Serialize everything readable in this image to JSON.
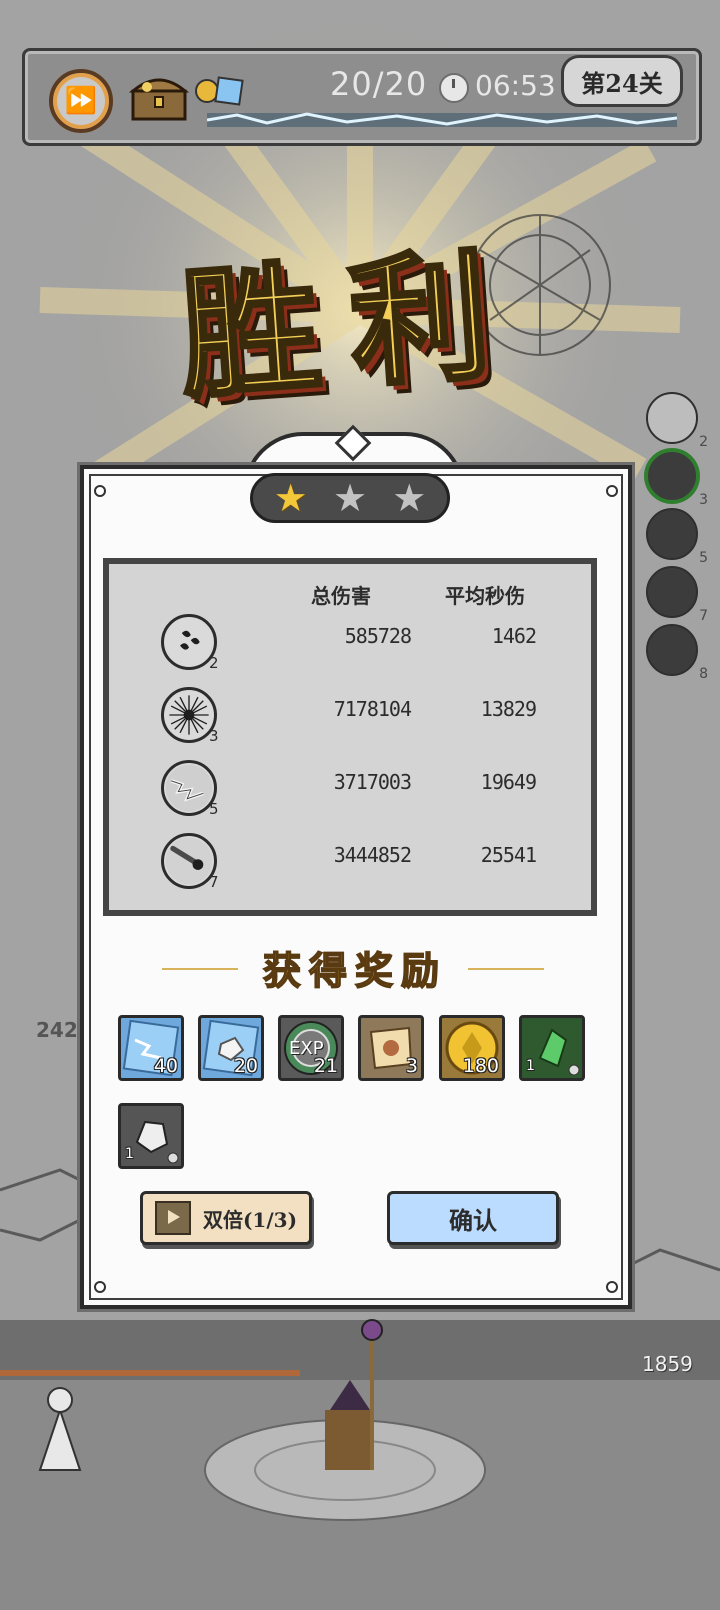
{
  "hud": {
    "wave": "20/20",
    "timer": "06:53",
    "level": "第24关"
  },
  "title": "胜利",
  "stars": {
    "earned": 1,
    "total": 3
  },
  "stats": {
    "col_total": "总伤害",
    "col_dps": "平均秒伤",
    "rows": [
      {
        "icon": "drops-skill-icon",
        "level": "2",
        "total": "585728",
        "dps": "1462"
      },
      {
        "icon": "thorn-burst-skill-icon",
        "level": "3",
        "total": "7178104",
        "dps": "13829"
      },
      {
        "icon": "lightning-skill-icon",
        "level": "5",
        "total": "3717003",
        "dps": "19649"
      },
      {
        "icon": "meteor-skill-icon",
        "level": "7",
        "total": "3444852",
        "dps": "25541"
      }
    ]
  },
  "rewards": {
    "title": "获得奖励",
    "items": [
      {
        "icon": "lightning-crystal-icon",
        "count": "40"
      },
      {
        "icon": "ice-crystal-icon",
        "count": "20"
      },
      {
        "icon": "exp-icon",
        "count": "21",
        "label": "EXP"
      },
      {
        "icon": "scroll-icon",
        "count": "3"
      },
      {
        "icon": "gold-coin-icon",
        "count": "180"
      },
      {
        "icon": "green-gem-icon",
        "count": "1"
      },
      {
        "icon": "stone-ore-icon",
        "count": "1"
      }
    ]
  },
  "buttons": {
    "double": "双倍(1/3)",
    "confirm": "确认"
  },
  "side_skills": [
    "2",
    "3",
    "5",
    "7",
    "8"
  ],
  "battle": {
    "hp": "1859",
    "side_number": "242"
  },
  "colors": {
    "gold": "#f3cf57",
    "confirm_bg": "#bcdcff",
    "double_bg": "#f3e0c2",
    "star_on": "#f3c73a"
  }
}
